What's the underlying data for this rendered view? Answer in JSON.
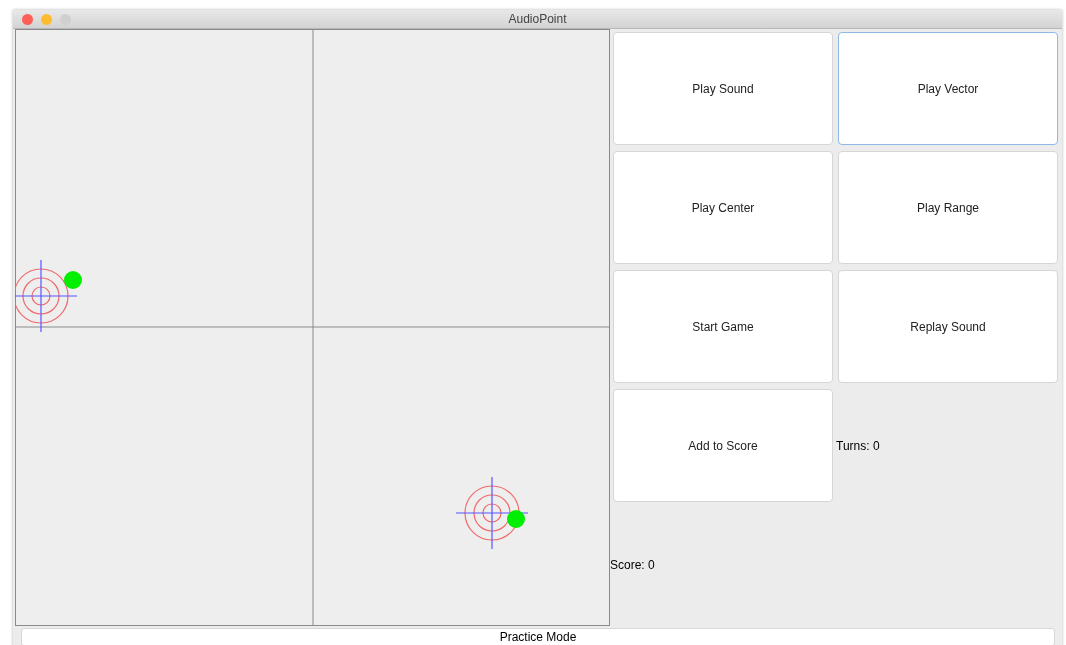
{
  "window": {
    "title": "AudioPoint"
  },
  "buttons": [
    {
      "label": "Play Sound",
      "focused": false
    },
    {
      "label": "Play Vector",
      "focused": true
    },
    {
      "label": "Play Center",
      "focused": false
    },
    {
      "label": "Play Range",
      "focused": false
    },
    {
      "label": "Start Game",
      "focused": false
    },
    {
      "label": "Replay Sound",
      "focused": false
    },
    {
      "label": "Add to Score",
      "focused": false
    }
  ],
  "turns_label": "Turns: 0",
  "score_label": "Score: 0",
  "mode_bar": "Practice Mode"
}
